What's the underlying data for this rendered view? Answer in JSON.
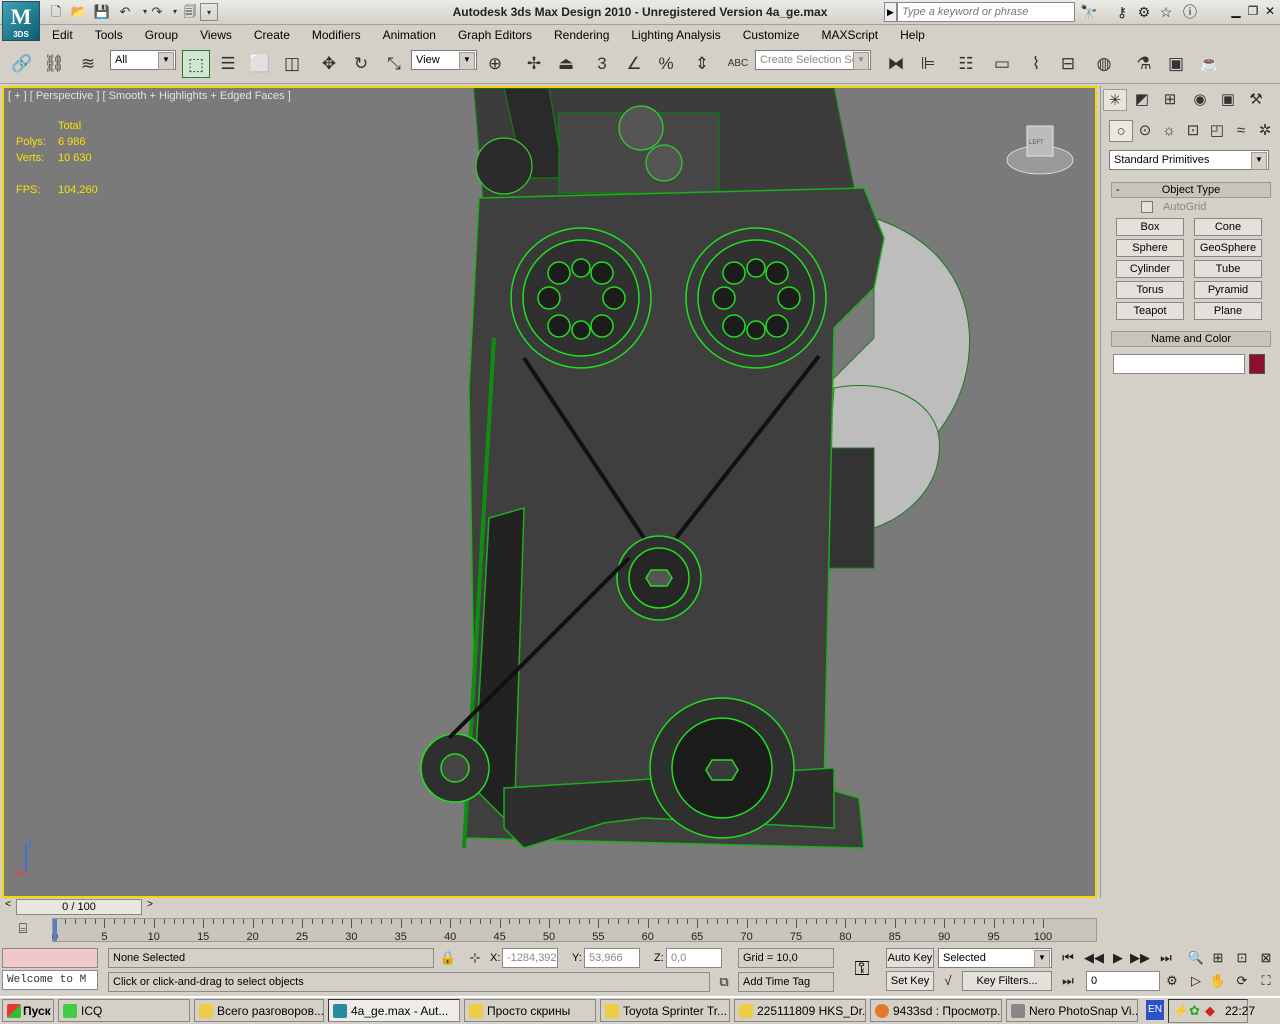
{
  "window": {
    "title": "Autodesk 3ds Max Design 2010  - Unregistered Version    4a_ge.max",
    "search_placeholder": "Type a keyword or phrase",
    "app_badge": "3DS",
    "app_letter": "M"
  },
  "menu": [
    "Edit",
    "Tools",
    "Group",
    "Views",
    "Create",
    "Modifiers",
    "Animation",
    "Graph Editors",
    "Rendering",
    "Lighting Analysis",
    "Customize",
    "MAXScript",
    "Help"
  ],
  "toolbar": {
    "filter_value": "All",
    "refcoord_value": "View",
    "selection_set_placeholder": "Create Selection Se",
    "snap_label": "3",
    "percent_label": "%",
    "abc_label": "ABC"
  },
  "viewport": {
    "label": "[ + ] [ Perspective ] [ Smooth + Highlights + Edged Faces ]",
    "stats_header": "Total",
    "polys_label": "Polys:",
    "polys_value": "6 986",
    "verts_label": "Verts:",
    "verts_value": "10 630",
    "fps_label": "FPS:",
    "fps_value": "104,260",
    "viewcube_label": "LEFT",
    "axis_label": "z"
  },
  "command_panel": {
    "category": "Standard Primitives",
    "object_type_header": "Object Type",
    "autogrid_label": "AutoGrid",
    "buttons": [
      "Box",
      "Cone",
      "Sphere",
      "GeoSphere",
      "Cylinder",
      "Tube",
      "Torus",
      "Pyramid",
      "Teapot",
      "Plane"
    ],
    "name_color_header": "Name and Color",
    "color_swatch": "#8a1030",
    "collapse_marker": "-"
  },
  "timeline": {
    "slider_label": "0 / 100",
    "ticks": [
      "0",
      "5",
      "10",
      "15",
      "20",
      "25",
      "30",
      "35",
      "40",
      "45",
      "50",
      "55",
      "60",
      "65",
      "70",
      "75",
      "80",
      "85",
      "90",
      "95",
      "100"
    ]
  },
  "status": {
    "maxscript_listener": "Welcome to M",
    "selection": "None Selected",
    "prompt": "Click or click-and-drag to select objects",
    "x_label": "X:",
    "x_value": "-1284,392",
    "y_label": "Y:",
    "y_value": "53,966",
    "z_label": "Z:",
    "z_value": "0,0",
    "grid": "Grid = 10,0",
    "add_time_tag": "Add Time Tag",
    "auto_key": "Auto Key",
    "set_key": "Set Key",
    "key_mode": "Selected",
    "key_filters": "Key Filters...",
    "frame_value": "0"
  },
  "taskbar": {
    "start": "Пуск",
    "tasks": [
      "ICQ",
      "Всего разговоров...",
      "4a_ge.max - Aut...",
      "Просто скрины",
      "Toyota Sprinter Tr...",
      "225111809 HKS_Dr...",
      "9433sd : Просмотр...",
      "Nero PhotoSnap Vi..."
    ],
    "lang": "EN",
    "clock": "22:27"
  }
}
